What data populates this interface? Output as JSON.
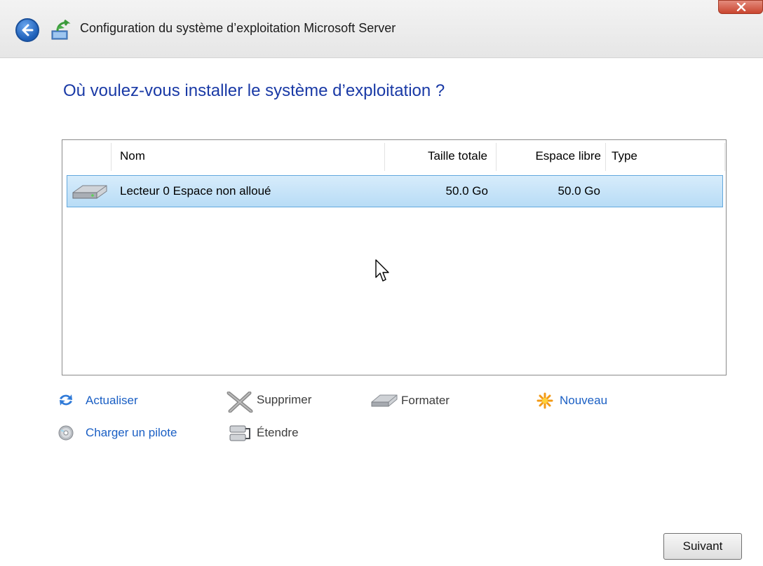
{
  "window": {
    "title": "Configuration du système d’exploitation Microsoft Server"
  },
  "heading": "Où voulez-vous installer le système d’exploitation ?",
  "table": {
    "columns": {
      "name": "Nom",
      "total": "Taille totale",
      "free": "Espace libre",
      "type": "Type"
    },
    "rows": [
      {
        "name": "Lecteur 0 Espace non alloué",
        "total": "50.0 Go",
        "free": "50.0 Go",
        "type": "",
        "selected": true,
        "icon": "hard-drive-icon"
      }
    ]
  },
  "actions": {
    "actualiser": "Actualiser",
    "supprimer": "Supprimer",
    "formater": "Formater",
    "nouveau": "Nouveau",
    "charger": "Charger un pilote",
    "etendre": "Étendre"
  },
  "buttons": {
    "next": "Suivant"
  },
  "colors": {
    "heading": "#1a3aa6",
    "link": "#1a5fc4",
    "selection": "#b8dcf6"
  }
}
